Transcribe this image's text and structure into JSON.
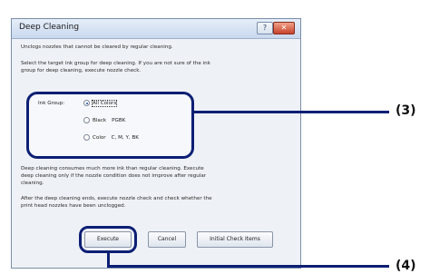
{
  "window": {
    "title": "Deep Cleaning",
    "help_glyph": "?",
    "close_glyph": "✕"
  },
  "body": {
    "intro": "Unclogs nozzles that cannot be cleared by regular cleaning.",
    "select_prompt_1": "Select the target ink group for deep cleaning. If you are not sure of the ink",
    "select_prompt_2": "group for deep cleaning, execute nozzle check.",
    "warning_1": "Deep cleaning consumes much more ink than regular cleaning. Execute",
    "warning_2": "deep cleaning only if the nozzle condition does not improve after regular",
    "warning_3": "cleaning.",
    "after_1": "After the deep cleaning ends, execute nozzle check and check whether the",
    "after_2": "print head nozzles have been unclogged."
  },
  "ink_group": {
    "label": "Ink Group:",
    "options": [
      {
        "label": "All Colors",
        "colors": "",
        "selected": true
      },
      {
        "label": "Black",
        "colors": "PGBK",
        "selected": false
      },
      {
        "label": "Color",
        "colors": "C, M, Y, BK",
        "selected": false
      }
    ]
  },
  "buttons": {
    "execute": "Execute",
    "cancel": "Cancel",
    "initial_check": "Initial Check Items"
  },
  "callouts": {
    "group": "(3)",
    "execute": "(4)"
  }
}
